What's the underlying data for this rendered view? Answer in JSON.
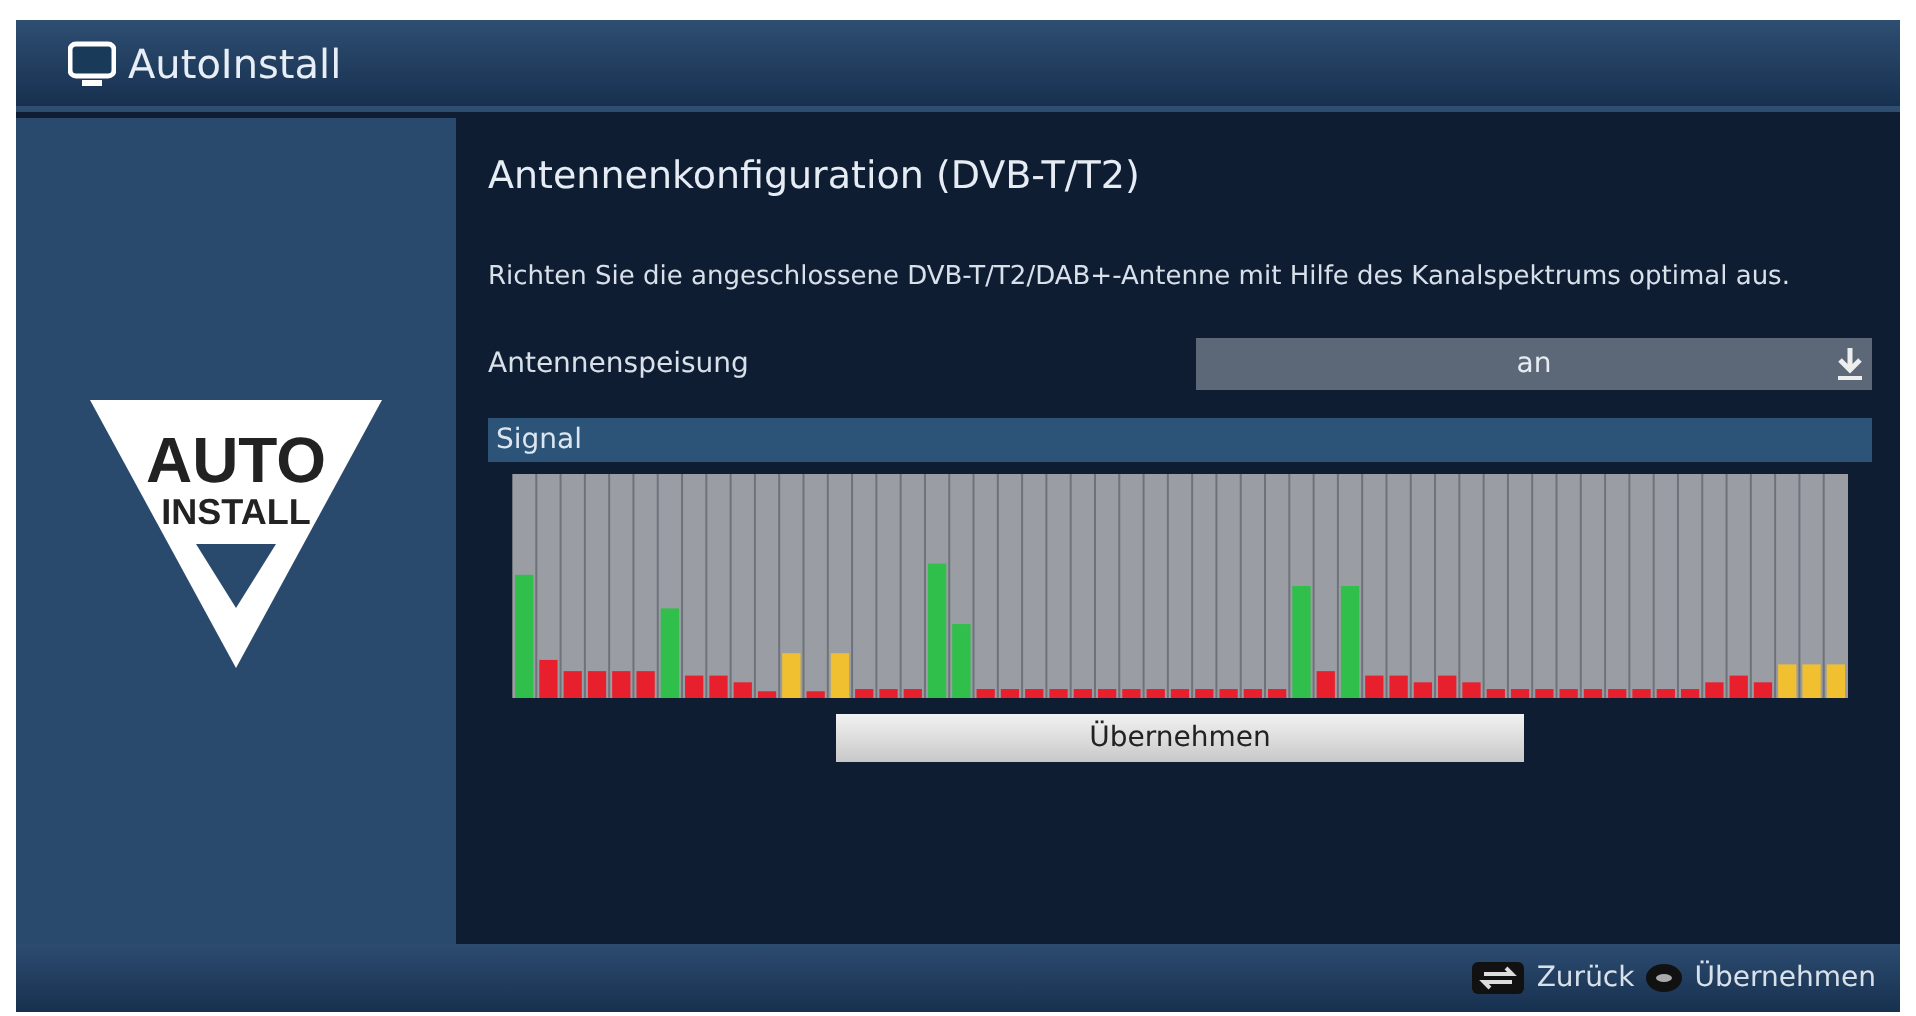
{
  "window": {
    "title": "AutoInstall"
  },
  "logo": {
    "line_1": "AUTO",
    "line_2": "INSTALL"
  },
  "heading": "Antennenkonfiguration (DVB-T/T2)",
  "description": "Richten Sie die angeschlossene DVB-T/T2/DAB+-Antenne mit Hilfe des Kanalspektrums optimal aus.",
  "setting": {
    "label": "Antennenspeisung",
    "value": "an"
  },
  "signal": {
    "label": "Signal"
  },
  "apply_button": "Übernehmen",
  "footer": [
    {
      "kind": "back",
      "label": "Zurück"
    },
    {
      "kind": "ok",
      "label": "Übernehmen"
    }
  ]
}
